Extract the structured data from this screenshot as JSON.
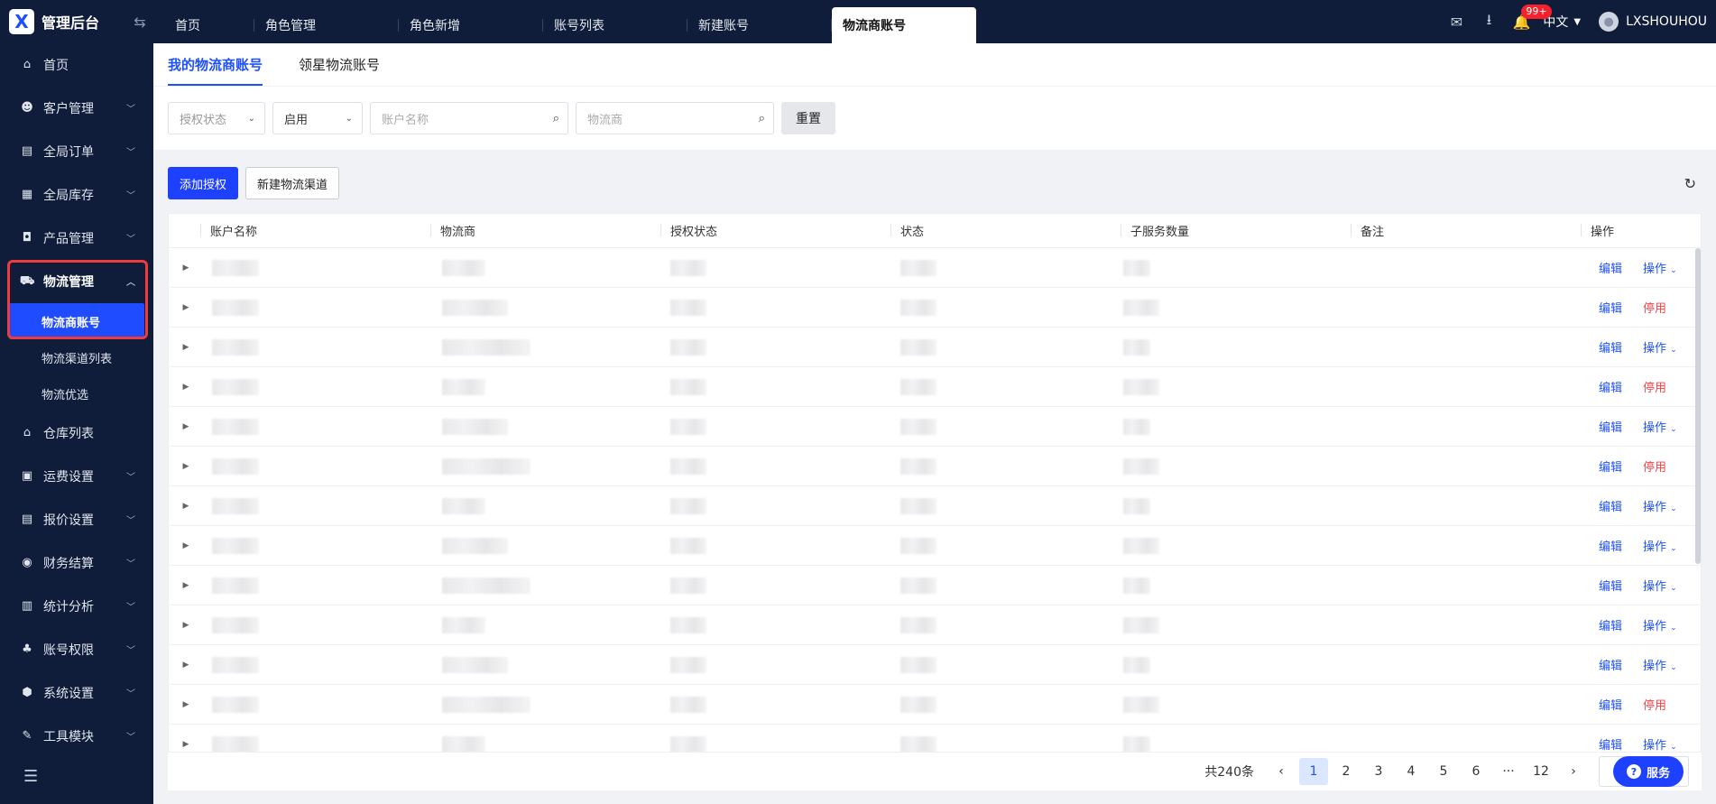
{
  "app": {
    "title": "管理后台"
  },
  "tabs": [
    "首页",
    "角色管理",
    "角色新增",
    "账号列表",
    "新建账号",
    "物流商账号"
  ],
  "header": {
    "badge": "99+",
    "lang": "中文",
    "user": "LXSHOUHOU"
  },
  "sidebar": {
    "items": [
      {
        "label": "首页",
        "icon": "home-icon"
      },
      {
        "label": "客户管理",
        "icon": "users-icon"
      },
      {
        "label": "全局订单",
        "icon": "orders-icon"
      },
      {
        "label": "全局库存",
        "icon": "inventory-icon"
      },
      {
        "label": "产品管理",
        "icon": "product-icon"
      },
      {
        "label": "物流管理",
        "icon": "truck-icon"
      },
      {
        "label": "仓库列表",
        "icon": "warehouse-icon"
      },
      {
        "label": "运费设置",
        "icon": "box-icon"
      },
      {
        "label": "报价设置",
        "icon": "quote-icon"
      },
      {
        "label": "财务结算",
        "icon": "money-icon"
      },
      {
        "label": "统计分析",
        "icon": "chart-icon"
      },
      {
        "label": "账号权限",
        "icon": "org-icon"
      },
      {
        "label": "系统设置",
        "icon": "settings-icon"
      },
      {
        "label": "工具模块",
        "icon": "wrench-icon"
      }
    ],
    "sub_items": [
      "物流商账号",
      "物流渠道列表",
      "物流优选"
    ]
  },
  "subtabs": [
    "我的物流商账号",
    "领星物流账号"
  ],
  "filters": {
    "auth_status_placeholder": "授权状态",
    "status_value": "启用",
    "account_placeholder": "账户名称",
    "carrier_placeholder": "物流商",
    "reset": "重置"
  },
  "toolbar": {
    "add": "添加授权",
    "new_channel": "新建物流渠道"
  },
  "table": {
    "columns": [
      "账户名称",
      "物流商",
      "授权状态",
      "状态",
      "子服务数量",
      "备注",
      "操作"
    ],
    "rows": [
      {
        "edit": "编辑",
        "action": "操作"
      },
      {
        "edit": "编辑",
        "action": "停用"
      },
      {
        "edit": "编辑",
        "action": "操作"
      },
      {
        "edit": "编辑",
        "action": "停用"
      },
      {
        "edit": "编辑",
        "action": "操作"
      },
      {
        "edit": "编辑",
        "action": "停用"
      },
      {
        "edit": "编辑",
        "action": "操作"
      },
      {
        "edit": "编辑",
        "action": "操作"
      },
      {
        "edit": "编辑",
        "action": "操作"
      },
      {
        "edit": "编辑",
        "action": "操作"
      },
      {
        "edit": "编辑",
        "action": "操作"
      },
      {
        "edit": "编辑",
        "action": "停用"
      },
      {
        "edit": "编辑",
        "action": "操作"
      }
    ]
  },
  "pager": {
    "total": "共240条",
    "pages": [
      "1",
      "2",
      "3",
      "4",
      "5",
      "6",
      "···",
      "12"
    ],
    "current": "1"
  },
  "service": "服务"
}
